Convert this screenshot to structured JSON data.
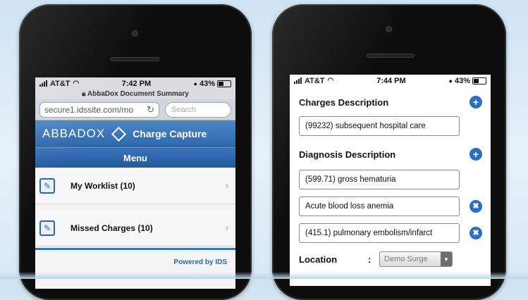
{
  "phone1": {
    "status": {
      "carrier": "AT&T",
      "time": "7:42 PM",
      "battery": "43%"
    },
    "browser": {
      "page_title": "AbbaDox Document Summary",
      "url": "secure1.idssite.com/mo",
      "search_placeholder": "Search"
    },
    "brand": {
      "name": "ABBADOX",
      "app": "Charge Capture"
    },
    "menu": {
      "title": "Menu",
      "items": [
        {
          "label": "My Worklist (10)"
        },
        {
          "label": "Missed Charges (10)"
        }
      ]
    },
    "footer": "Powered by IDS"
  },
  "phone2": {
    "status": {
      "carrier": "AT&T",
      "time": "7:44 PM",
      "battery": "43%"
    },
    "charges": {
      "title": "Charges Description",
      "items": [
        {
          "value": "(99232) subsequent hospital care"
        }
      ]
    },
    "diagnosis": {
      "title": "Diagnosis Description",
      "items": [
        {
          "value": "(599.71) gross hematuria"
        },
        {
          "value": "Acute blood loss anemia"
        },
        {
          "value": "(415.1) pulmonary embolism/infarct"
        }
      ]
    },
    "location": {
      "label": "Location",
      "separator": ":",
      "selected": "Demo Surge"
    }
  },
  "colors": {
    "accent": "#2e66aa",
    "button_blue": "#2a6fc2"
  },
  "icons": [
    "signal-bars-icon",
    "wifi-icon",
    "battery-icon",
    "lock-icon",
    "reload-icon",
    "abbadox-diamond-icon",
    "document-edit-icon",
    "chevron-right-icon",
    "plus-circle-icon",
    "x-circle-icon",
    "dropdown-arrow-icon"
  ]
}
